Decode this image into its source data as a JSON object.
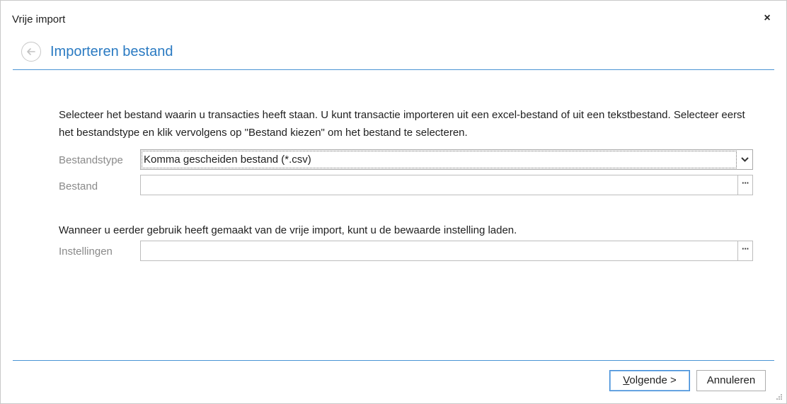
{
  "window": {
    "title": "Vrije import",
    "close_icon": "×"
  },
  "header": {
    "title": "Importeren bestand",
    "back_icon": "arrow-left-circle"
  },
  "intro": {
    "text": "Selecteer het bestand waarin u transacties heeft staan. U kunt transactie importeren uit een excel-bestand of uit een tekstbestand. Selecteer eerst het bestandstype en klik vervolgens op \"Bestand kiezen\" om het bestand te selecteren."
  },
  "fields": {
    "file_type": {
      "label": "Bestandstype",
      "value": "Komma gescheiden bestand (*.csv)"
    },
    "file": {
      "label": "Bestand",
      "value": ""
    },
    "settings": {
      "label": "Instellingen",
      "value": ""
    }
  },
  "settings_intro": {
    "text": "Wanneer u eerder gebruik heeft gemaakt van de vrije import, kunt u de bewaarde instelling laden."
  },
  "buttons": {
    "next_mnemonic": "V",
    "next_rest": "olgende >",
    "cancel": "Annuleren"
  },
  "colors": {
    "accent": "#2a7ac2",
    "rule": "#4a94d4",
    "label": "#8a8a8a"
  }
}
